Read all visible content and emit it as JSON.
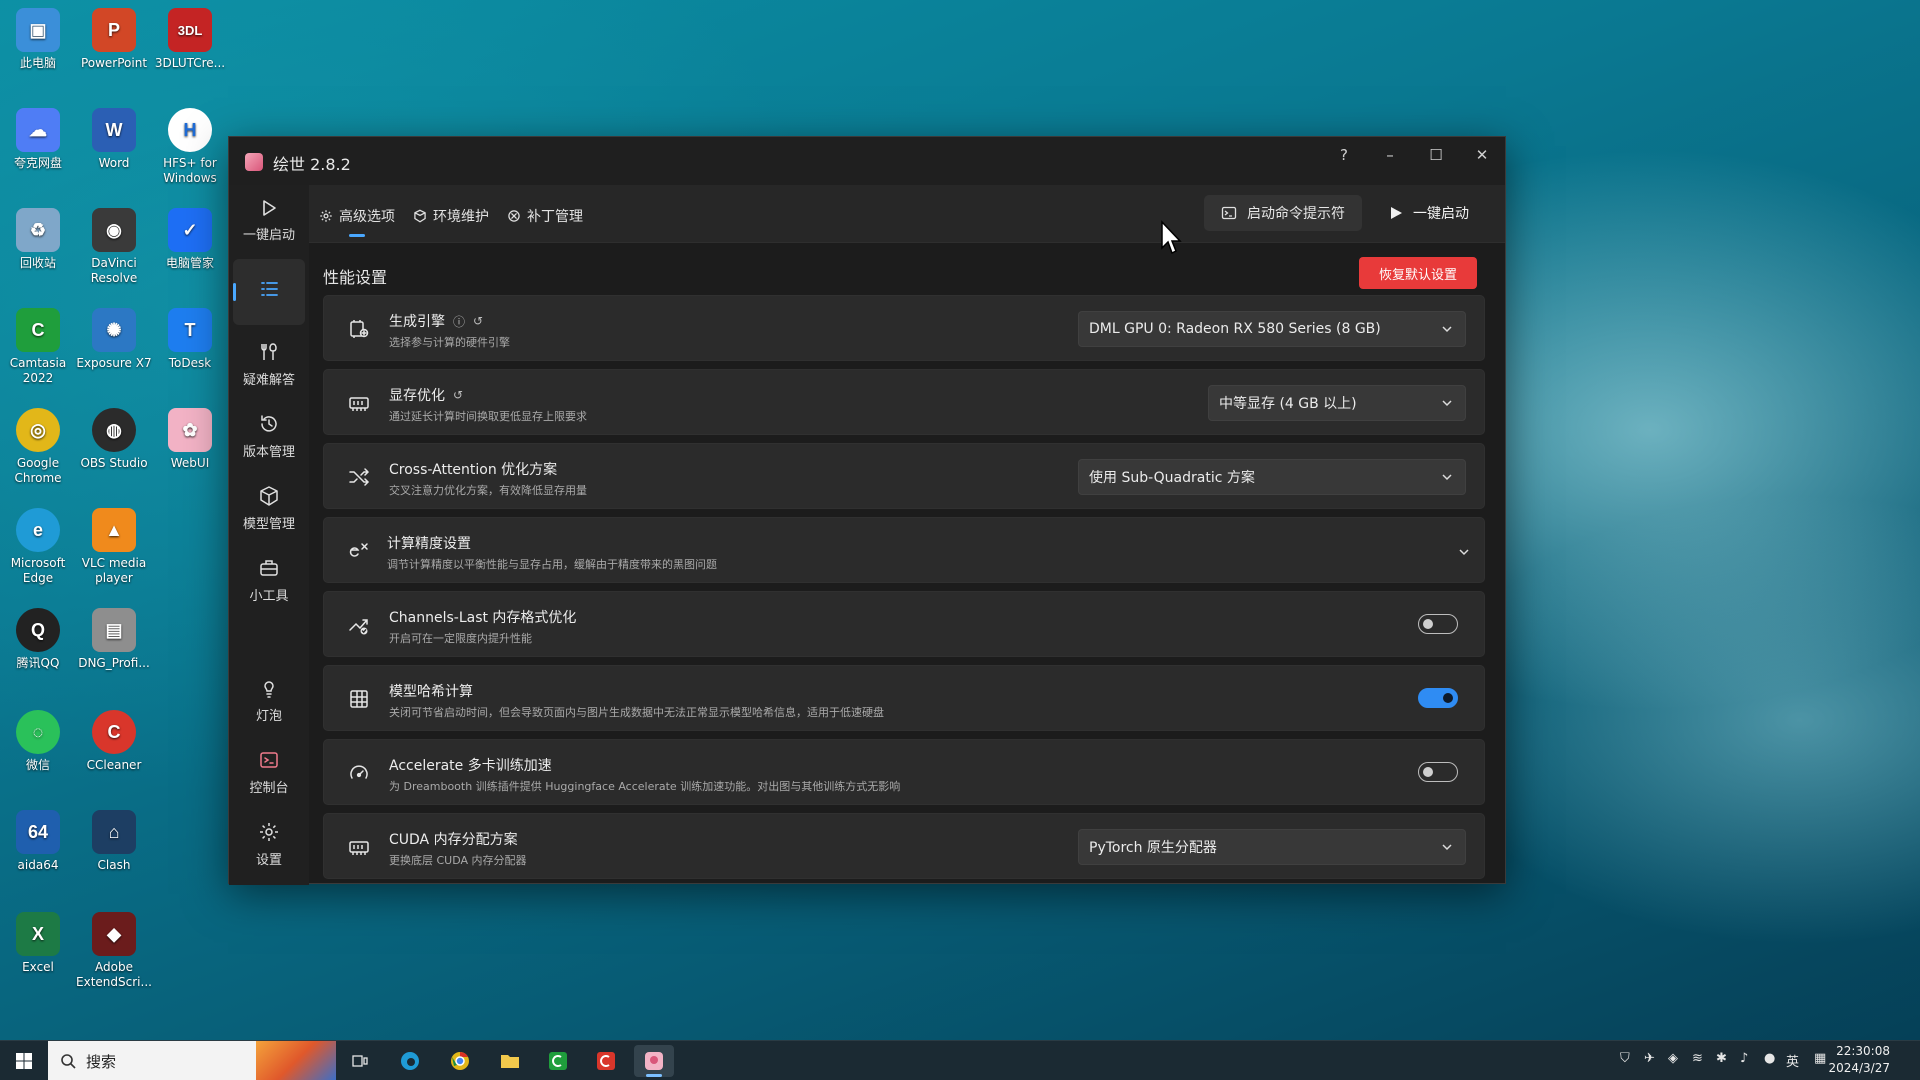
{
  "desktop": {
    "icons": [
      {
        "label": "此电脑",
        "glyph": "▣",
        "color": "#3b8fd9"
      },
      {
        "label": "PowerPoint",
        "glyph": "P",
        "color": "#d24726"
      },
      {
        "label": "3DLUTCre...",
        "glyph": "3DL",
        "color": "#c42424"
      },
      {
        "label": "夸克网盘",
        "glyph": "☁",
        "color": "#4f7df5"
      },
      {
        "label": "Word",
        "glyph": "W",
        "color": "#2b5fb4"
      },
      {
        "label": "HFS+ for Windows",
        "glyph": "H",
        "color": "#ffffff"
      },
      {
        "label": "回收站",
        "glyph": "♻",
        "color": "#7fa7c9"
      },
      {
        "label": "DaVinci Resolve",
        "glyph": "◉",
        "color": "#3a3a3a"
      },
      {
        "label": "电脑管家",
        "glyph": "✓",
        "color": "#1e6ff5"
      },
      {
        "label": "Camtasia 2022",
        "glyph": "C",
        "color": "#1f9e3c"
      },
      {
        "label": "Exposure X7",
        "glyph": "✺",
        "color": "#2c78c4"
      },
      {
        "label": "ToDesk",
        "glyph": "T",
        "color": "#1e7ef0"
      },
      {
        "label": "Google Chrome",
        "glyph": "◎",
        "color": "#e2b719"
      },
      {
        "label": "OBS Studio",
        "glyph": "◍",
        "color": "#2b2b2b"
      },
      {
        "label": "WebUI",
        "glyph": "✿",
        "color": "#f3b3c6"
      },
      {
        "label": "Microsoft Edge",
        "glyph": "e",
        "color": "#1f9bd6"
      },
      {
        "label": "VLC media player",
        "glyph": "▲",
        "color": "#f08a1c"
      },
      {
        "label": "腾讯QQ",
        "glyph": "Q",
        "color": "#222222"
      },
      {
        "label": "DNG_Profi...",
        "glyph": "▤",
        "color": "#8e8e8e"
      },
      {
        "label": "微信",
        "glyph": "◌",
        "color": "#2ac15a"
      },
      {
        "label": "CCleaner",
        "glyph": "C",
        "color": "#d9362b"
      },
      {
        "label": "aida64",
        "glyph": "64",
        "color": "#1f5fae"
      },
      {
        "label": "Clash",
        "glyph": "⌂",
        "color": "#1d3e63"
      },
      {
        "label": "Excel",
        "glyph": "X",
        "color": "#1d7a45"
      },
      {
        "label": "Adobe ExtendScri...",
        "glyph": "◆",
        "color": "#6b1c1c"
      }
    ]
  },
  "window": {
    "title": "绘世 2.8.2",
    "controls": {
      "help": "?",
      "minimize": "–",
      "maximize": "☐",
      "close": "✕"
    }
  },
  "sidebar": {
    "items": [
      {
        "label": "一键启动",
        "icon": "play-icon"
      },
      {
        "label": "",
        "icon": "list-icon"
      },
      {
        "label": "疑难解答",
        "icon": "tools-icon"
      },
      {
        "label": "版本管理",
        "icon": "history-icon"
      },
      {
        "label": "模型管理",
        "icon": "cube-icon"
      },
      {
        "label": "小工具",
        "icon": "toolbox-icon"
      },
      {
        "label": "灯泡",
        "icon": "bulb-icon"
      },
      {
        "label": "控制台",
        "icon": "console-icon"
      },
      {
        "label": "设置",
        "icon": "gear-icon"
      }
    ]
  },
  "tabs": [
    {
      "label": "高级选项",
      "icon": "gear-icon"
    },
    {
      "label": "环境维护",
      "icon": "package-icon"
    },
    {
      "label": "补丁管理",
      "icon": "patch-icon"
    }
  ],
  "toolbar": {
    "cmd_label": "启动命令提示符",
    "launch_label": "一键启动",
    "reset_label": "恢复默认设置"
  },
  "section": {
    "title": "性能设置"
  },
  "settings": [
    {
      "title": "生成引擎",
      "desc": "选择参与计算的硬件引擎",
      "type": "select",
      "value": "DML GPU 0: Radeon RX 580 Series (8 GB)",
      "icon": "engine-icon"
    },
    {
      "title": "显存优化",
      "desc": "通过延长计算时间换取更低显存上限要求",
      "type": "select",
      "value": "中等显存 (4 GB 以上)",
      "icon": "memory-icon"
    },
    {
      "title": "Cross-Attention 优化方案",
      "desc": "交叉注意力优化方案，有效降低显存用量",
      "type": "select",
      "value": "使用 Sub-Quadratic 方案",
      "icon": "shuffle-icon"
    },
    {
      "title": "计算精度设置",
      "desc": "调节计算精度以平衡性能与显存占用，缓解由于精度带来的黑图问题",
      "type": "expand",
      "icon": "precision-icon"
    },
    {
      "title": "Channels-Last 内存格式优化",
      "desc": "开启可在一定限度内提升性能",
      "type": "toggle",
      "value": false,
      "icon": "chart-check-icon"
    },
    {
      "title": "模型哈希计算",
      "desc": "关闭可节省启动时间，但会导致页面内与图片生成数据中无法正常显示模型哈希信息，适用于低速硬盘",
      "type": "toggle",
      "value": true,
      "icon": "grid-icon"
    },
    {
      "title": "Accelerate 多卡训练加速",
      "desc": "为 Dreambooth 训练插件提供 Huggingface Accelerate 训练加速功能。对出图与其他训练方式无影响",
      "type": "toggle",
      "value": false,
      "icon": "gauge-icon"
    },
    {
      "title": "CUDA 内存分配方案",
      "desc": "更换底层 CUDA 内存分配器",
      "type": "select",
      "value": "PyTorch 原生分配器",
      "icon": "memory-icon"
    }
  ],
  "taskbar": {
    "search_label": "搜索",
    "tray_lang": "英",
    "time": "22:30:08",
    "date": "2024/3/27"
  }
}
